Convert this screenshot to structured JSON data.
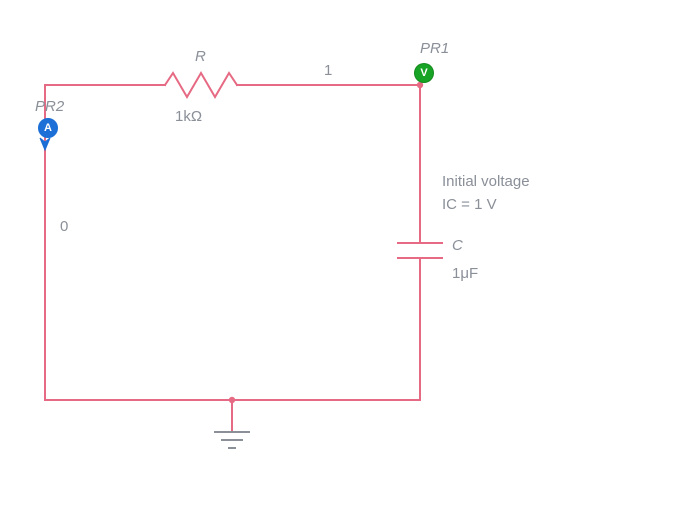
{
  "colors": {
    "wire": "#e66a84",
    "text": "#8a8f98",
    "probe_v": "#17a324",
    "probe_a": "#1b6fd6",
    "arrow": "#1b6fd6"
  },
  "labels": {
    "resistor_name": "R",
    "resistor_value": "1kΩ",
    "probe1_name": "PR1",
    "probe1_badge": "V",
    "probe2_name": "PR2",
    "probe2_badge": "A",
    "node_left": "0",
    "node_right": "1",
    "cap_ic_title": "Initial voltage",
    "cap_ic_value": "IC = 1 V",
    "cap_name": "C",
    "cap_value": "1μF"
  },
  "chart_data": {
    "type": "circuit-schematic",
    "nodes": [
      {
        "id": "0",
        "label": "0",
        "ground": true
      },
      {
        "id": "1",
        "label": "1"
      }
    ],
    "components": [
      {
        "ref": "R",
        "type": "resistor",
        "value": "1kΩ",
        "value_ohms": 1000,
        "nodes": [
          "0",
          "1"
        ]
      },
      {
        "ref": "C",
        "type": "capacitor",
        "value": "1μF",
        "value_farads": 1e-06,
        "initial_condition": "1 V",
        "initial_condition_volts": 1,
        "nodes": [
          "1",
          "0"
        ]
      }
    ],
    "probes": [
      {
        "ref": "PR1",
        "type": "voltage",
        "node": "1"
      },
      {
        "ref": "PR2",
        "type": "current",
        "branch": "left-wire"
      }
    ]
  }
}
